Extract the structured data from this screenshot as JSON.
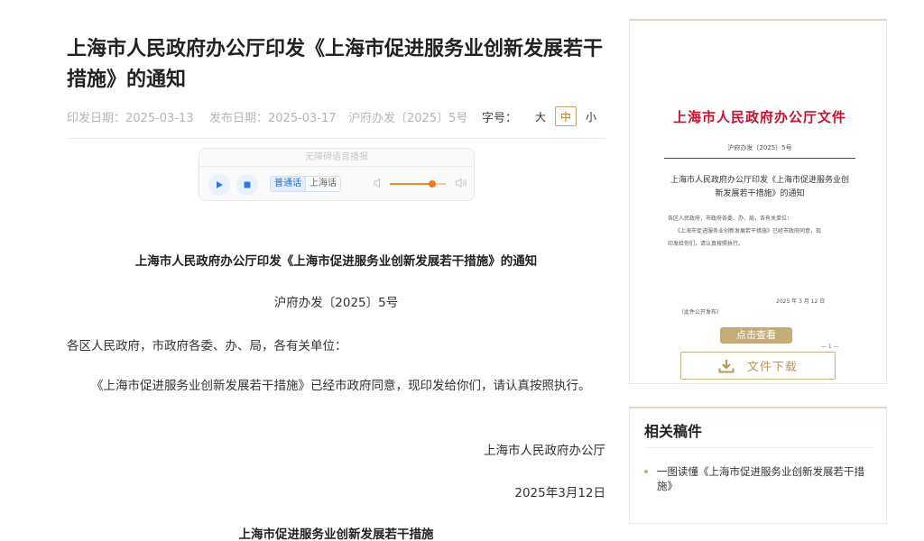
{
  "article": {
    "title": "上海市人民政府办公厅印发《上海市促进服务业创新发展若干措施》的通知",
    "meta": {
      "issue_date": "印发日期：2025-03-13",
      "publish_date": "发布日期：2025-03-17",
      "doc_number": "沪府办发〔2025〕5号"
    },
    "font_size": {
      "label": "字号：",
      "large": "大",
      "medium": "中",
      "small": "小",
      "selected": "中"
    }
  },
  "player": {
    "header": "无障碍语音播报",
    "lang_mandarin": "普通话",
    "lang_shanghainese": "上海话",
    "selected_lang": "普通话",
    "volume": 0.75
  },
  "body": {
    "doc_title": "上海市人民政府办公厅印发《上海市促进服务业创新发展若干措施》的通知",
    "doc_number": "沪府办发〔2025〕5号",
    "salutation": "各区人民政府，市政府各委、办、局，各有关单位：",
    "paragraph": "《上海市促进服务业创新发展若干措施》已经市政府同意，现印发给你们，请认真按照执行。",
    "signature_org": "上海市人民政府办公厅",
    "signature_date": "2025年3月12日",
    "sub_title": "上海市促进服务业创新发展若干措施"
  },
  "preview": {
    "header": "上海市人民政府办公厅文件",
    "doc_number": "沪府办发〔2025〕5号",
    "title": "上海市人民政府办公厅印发《上海市促进服务业创新发展若干措施》的通知",
    "line1": "各区人民政府，市政府各委、办、局，各有关单位：",
    "line2": "《上海市促进服务业创新发展若干措施》已经市政府同意，现",
    "line3": "印发给你们，请认真按照执行。",
    "date": "2025 年 3 月 12 日",
    "publish_note": "（此件公开发布）",
    "page": "— 1 —",
    "view_button": "点击查看",
    "download_button": "文件下载"
  },
  "related": {
    "title": "相关稿件",
    "items": [
      "一图读懂《上海市促进服务业创新发展若干措施》"
    ]
  },
  "colors": {
    "accent_gold": "#c7ab77",
    "red_head": "#c8102e",
    "slider_orange": "#f07b1a"
  }
}
